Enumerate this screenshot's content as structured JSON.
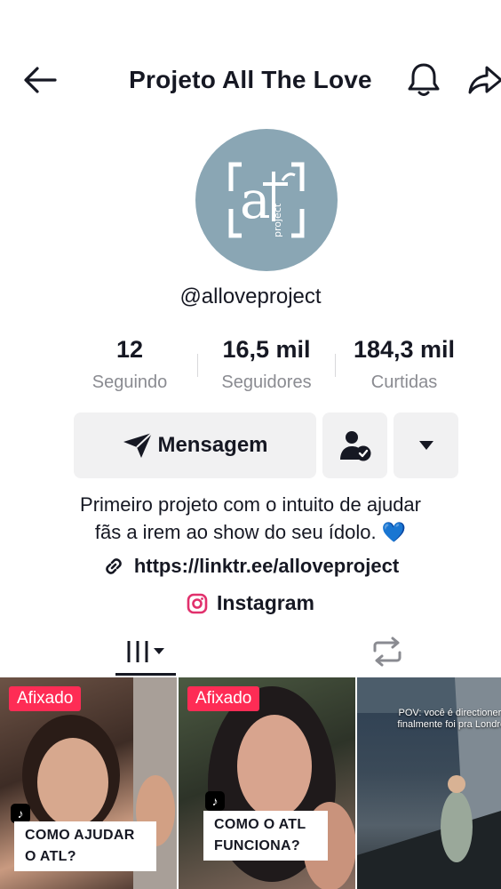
{
  "header": {
    "title": "Projeto All The Love",
    "back_icon": "arrow-left-icon",
    "bell_icon": "bell-icon",
    "share_icon": "share-icon"
  },
  "profile": {
    "username": "@alloveproject",
    "avatar_color": "#8aa6b4"
  },
  "stats": [
    {
      "value": "12",
      "label": "Seguindo"
    },
    {
      "value": "16,5 mil",
      "label": "Seguidores"
    },
    {
      "value": "184,3 mil",
      "label": "Curtidas"
    }
  ],
  "actions": {
    "message_label": "Mensagem"
  },
  "bio": {
    "line1": "Primeiro projeto com o intuito de ajudar",
    "line2": "fãs a irem ao show do seu ídolo. 💙",
    "link": "https://linktr.ee/alloveproject",
    "instagram": "Instagram"
  },
  "videos": [
    {
      "badge": "Afixado",
      "caption_line1": "COMO AJUDAR",
      "caption_line2": "O ATL?"
    },
    {
      "badge": "Afixado",
      "caption_line1": "COMO O ATL",
      "caption_line2": "FUNCIONA?"
    },
    {
      "overlay_line1": "POV: você é directioner e",
      "overlay_line2": "finalmente foi pra Londres"
    }
  ],
  "colors": {
    "accent": "#fe2c55",
    "text": "#161823",
    "secondary": "#8a8b91",
    "button_bg": "#f1f1f2",
    "heart": "#1da1f2"
  }
}
